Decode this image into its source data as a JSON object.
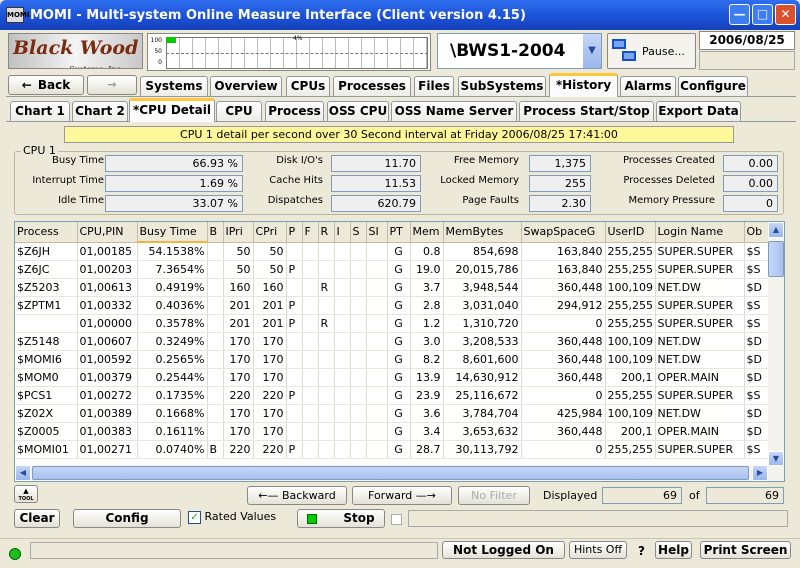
{
  "window": {
    "title": "MOMI - Multi-system Online Measure Interface (Client version 4.15)",
    "app_icon": "MOMI"
  },
  "logo": {
    "text": "Black Wood",
    "sub": "Systems, Inc."
  },
  "cpu_meter": {
    "scale": [
      "100",
      "50",
      "0"
    ],
    "percent_label": "4%",
    "level": 0.04
  },
  "system_selector": {
    "value": "\\BWS1-2004"
  },
  "pause_button": {
    "label": "Pause..."
  },
  "date": "2006/08/25",
  "nav": {
    "back": "Back"
  },
  "main_tabs": [
    "Systems",
    "Overview",
    "CPUs",
    "Processes",
    "Files",
    "SubSystems",
    "*History",
    "Alarms",
    "Configure"
  ],
  "sub_tabs": [
    "Chart 1",
    "Chart 2",
    "*CPU Detail",
    "CPU",
    "Process",
    "OSS CPU",
    "OSS Name Server",
    "Process Start/Stop",
    "Export Data"
  ],
  "banner": "CPU 1 detail per second over 30 Second interval at Friday 2006/08/25 17:41:00",
  "cpu_group": {
    "legend": "CPU 1",
    "col1": [
      {
        "label": "Busy Time",
        "value": "66.93 %"
      },
      {
        "label": "Interrupt Time",
        "value": "1.69 %"
      },
      {
        "label": "Idle Time",
        "value": "33.07 %"
      }
    ],
    "col2": [
      {
        "label": "Disk I/O's",
        "value": "11.70"
      },
      {
        "label": "Cache Hits",
        "value": "11.53"
      },
      {
        "label": "Dispatches",
        "value": "620.79"
      }
    ],
    "col3": [
      {
        "label": "Free Memory",
        "value": "1,375"
      },
      {
        "label": "Locked Memory",
        "value": "255"
      },
      {
        "label": "Page Faults",
        "value": "2.30"
      }
    ],
    "col4": [
      {
        "label": "Processes Created",
        "value": "0.00"
      },
      {
        "label": "Processes Deleted",
        "value": "0.00"
      },
      {
        "label": "Memory Pressure",
        "value": "0"
      }
    ]
  },
  "table": {
    "headers": [
      "Process",
      "CPU,PIN",
      "Busy Time",
      "B",
      "IPri",
      "CPri",
      "P",
      "F",
      "R",
      "I",
      "S",
      "SI",
      "PT",
      "Mem",
      "MemBytes",
      "SwapSpaceG",
      "UserID",
      "Login Name",
      "Ob"
    ],
    "rows": [
      [
        "$Z6JH",
        "01,00185",
        "54.1538%",
        "",
        "50",
        "50",
        "",
        "",
        "",
        "",
        "",
        "",
        "G",
        "0.8",
        "854,698",
        "163,840",
        "255,255",
        "SUPER.SUPER",
        "$S"
      ],
      [
        "$Z6JC",
        "01,00203",
        "7.3654%",
        "",
        "50",
        "50",
        "P",
        "",
        "",
        "",
        "",
        "",
        "G",
        "19.0",
        "20,015,786",
        "163,840",
        "255,255",
        "SUPER.SUPER",
        "$S"
      ],
      [
        "$Z5203",
        "01,00613",
        "0.4919%",
        "",
        "160",
        "160",
        "",
        "",
        "R",
        "",
        "",
        "",
        "G",
        "3.7",
        "3,948,544",
        "360,448",
        "100,109",
        "NET.DW",
        "$D"
      ],
      [
        "$ZPTM1",
        "01,00332",
        "0.4036%",
        "",
        "201",
        "201",
        "P",
        "",
        "",
        "",
        "",
        "",
        "G",
        "2.8",
        "3,031,040",
        "294,912",
        "255,255",
        "SUPER.SUPER",
        "$S"
      ],
      [
        "",
        "01,00000",
        "0.3578%",
        "",
        "201",
        "201",
        "P",
        "",
        "R",
        "",
        "",
        "",
        "G",
        "1.2",
        "1,310,720",
        "0",
        "255,255",
        "SUPER.SUPER",
        "$S"
      ],
      [
        "$Z5148",
        "01,00607",
        "0.3249%",
        "",
        "170",
        "170",
        "",
        "",
        "",
        "",
        "",
        "",
        "G",
        "3.0",
        "3,208,533",
        "360,448",
        "100,109",
        "NET.DW",
        "$D"
      ],
      [
        "$MOMI6",
        "01,00592",
        "0.2565%",
        "",
        "170",
        "170",
        "",
        "",
        "",
        "",
        "",
        "",
        "G",
        "8.2",
        "8,601,600",
        "360,448",
        "100,109",
        "NET.DW",
        "$D"
      ],
      [
        "$MOM0",
        "01,00379",
        "0.2544%",
        "",
        "170",
        "170",
        "",
        "",
        "",
        "",
        "",
        "",
        "G",
        "13.9",
        "14,630,912",
        "360,448",
        "200,1",
        "OPER.MAIN",
        "$D"
      ],
      [
        "$PCS1",
        "01,00272",
        "0.1735%",
        "",
        "220",
        "220",
        "P",
        "",
        "",
        "",
        "",
        "",
        "G",
        "23.9",
        "25,116,672",
        "0",
        "255,255",
        "SUPER.SUPER",
        "$S"
      ],
      [
        "$Z02X",
        "01,00389",
        "0.1668%",
        "",
        "170",
        "170",
        "",
        "",
        "",
        "",
        "",
        "",
        "G",
        "3.6",
        "3,784,704",
        "425,984",
        "100,109",
        "NET.DW",
        "$D"
      ],
      [
        "$Z0005",
        "01,00383",
        "0.1611%",
        "",
        "170",
        "170",
        "",
        "",
        "",
        "",
        "",
        "",
        "G",
        "3.4",
        "3,653,632",
        "360,448",
        "200,1",
        "OPER.MAIN",
        "$D"
      ],
      [
        "$MOMI01",
        "01,00271",
        "0.0740%",
        "B",
        "220",
        "220",
        "P",
        "",
        "",
        "",
        "",
        "",
        "G",
        "28.7",
        "30,113,792",
        "0",
        "255,255",
        "SUPER.SUPER",
        "$S"
      ]
    ]
  },
  "bottom": {
    "tool": "TOOL",
    "backward": "Backward",
    "forward": "Forward",
    "no_filter": "No Filter",
    "displayed_label": "Displayed",
    "displayed": "69",
    "of_label": "of",
    "total": "69"
  },
  "actions": {
    "clear": "Clear",
    "config": "Config",
    "rated": "Rated Values",
    "stop": "Stop"
  },
  "statusbar": {
    "not_logged": "Not Logged On",
    "hints": "Hints Off",
    "help_q": "?",
    "help": "Help",
    "print": "Print Screen"
  }
}
